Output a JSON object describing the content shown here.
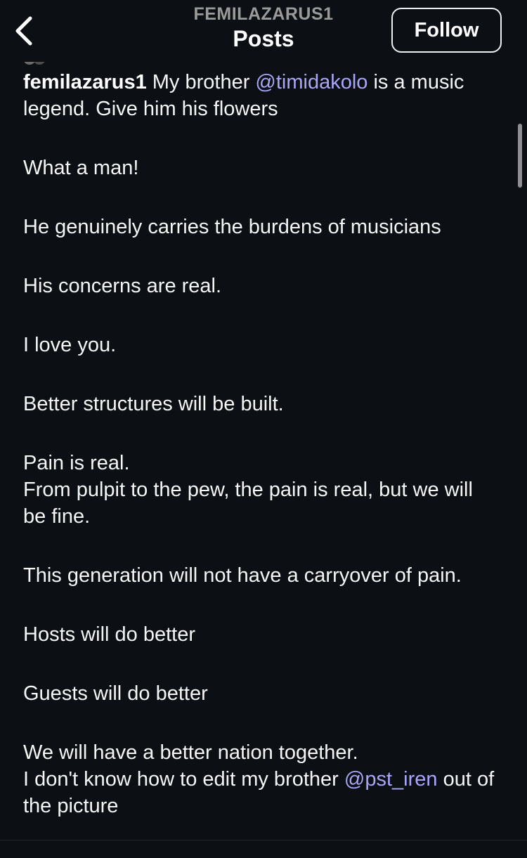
{
  "header": {
    "username": "FEMILAZARUS1",
    "title": "Posts",
    "follow_label": "Follow",
    "back_icon": "chevron-left-icon"
  },
  "post": {
    "author": "femilazarus1",
    "intro_text": " My brother ",
    "mention_1": "@timidakolo",
    "intro_rest": " is a music legend. Give him his flowers",
    "lines": [
      "What a man!",
      "He genuinely carries the burdens of musicians",
      "His concerns are real.",
      "I love you.",
      "Better structures will be built.",
      "Pain is real.",
      "From pulpit to the pew, the pain is real, but we will be fine.",
      "This generation will not have a carryover of pain.",
      "Hosts will do better",
      "Guests will do better",
      "We will have a better nation together."
    ],
    "last_text": "I don't know how to edit my brother ",
    "mention_2": "@pst_iren",
    "last_rest": " out of the picture"
  },
  "colors": {
    "background": "#0c1014",
    "mention": "#a9a6f7",
    "text": "#f5f5f5"
  }
}
